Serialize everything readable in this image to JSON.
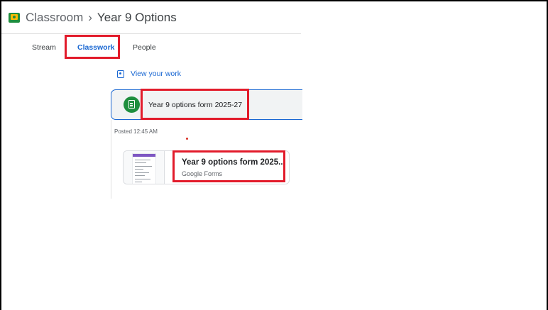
{
  "header": {
    "app_name": "Classroom",
    "separator": "›",
    "class_name": "Year 9 Options"
  },
  "tabs": [
    {
      "label": "Stream",
      "active": false
    },
    {
      "label": "Classwork",
      "active": true
    },
    {
      "label": "People",
      "active": false
    }
  ],
  "view_work": {
    "label": "View your work",
    "icon": "assignment-ind-icon"
  },
  "assignment": {
    "title": "Year 9 options form 2025-27",
    "icon": "assignment-icon",
    "posted": "Posted 12:45 AM",
    "attachment": {
      "title": "Year 9 options form 2025...",
      "type": "Google Forms"
    }
  },
  "colors": {
    "accent": "#1967d2",
    "classroom_green": "#1e8e3e",
    "highlight": "#e21b2b"
  }
}
